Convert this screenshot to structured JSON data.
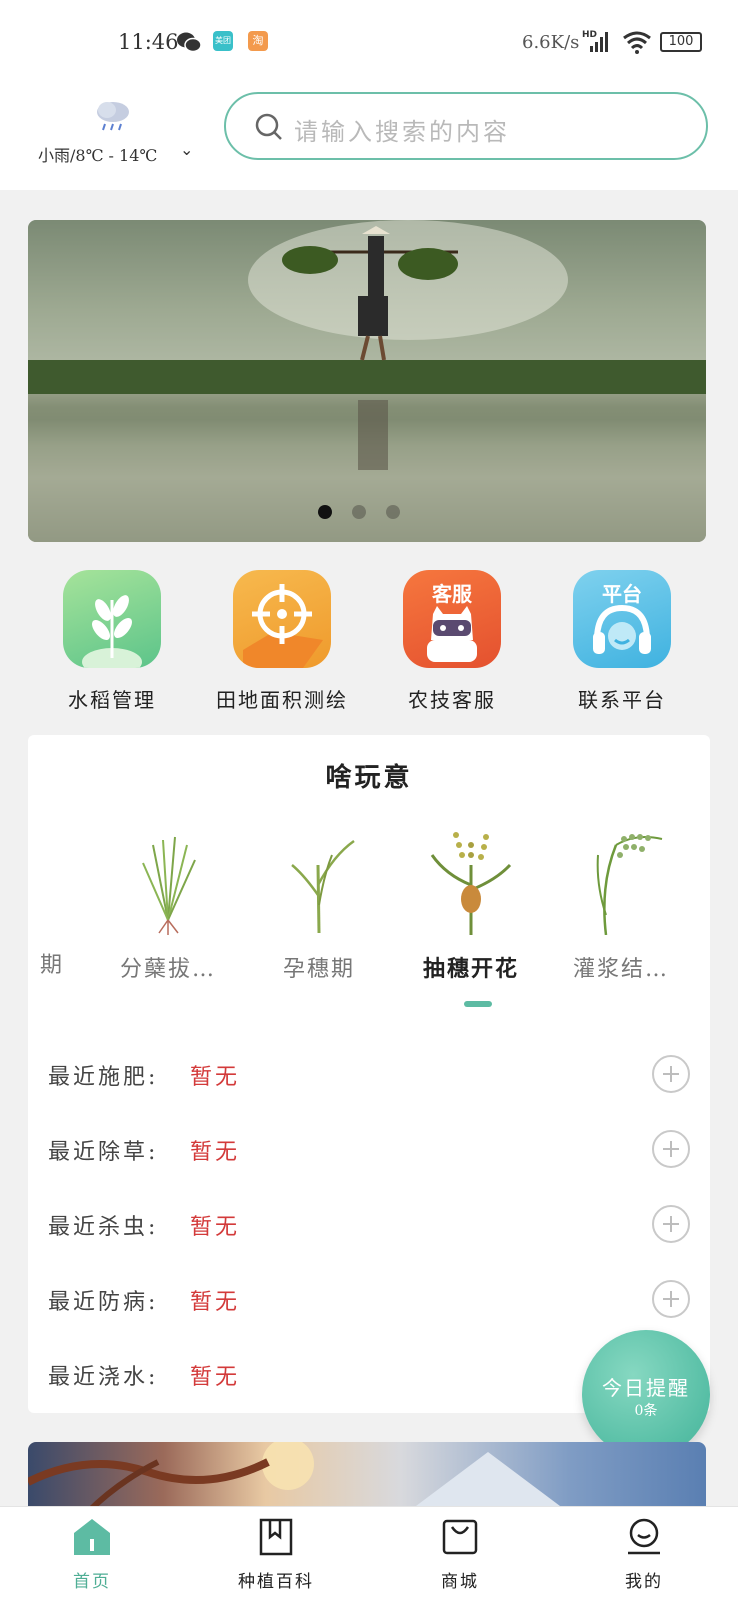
{
  "status_bar": {
    "time": "11:46",
    "net_speed": "6.6K/s",
    "battery": "100",
    "app_icon_1": "美团",
    "app_icon_2": "淘"
  },
  "header": {
    "weather": "小雨/8℃ - 14℃",
    "search_placeholder": "请输入搜索的内容"
  },
  "categories": [
    {
      "label": "水稻管理",
      "icon": "rice-plant-icon",
      "color": "#7fd08e"
    },
    {
      "label": "田地面积测绘",
      "icon": "crosshair-field-icon",
      "color": "#f2a13a",
      "icon_text": ""
    },
    {
      "label": "农技客服",
      "icon": "robot-service-icon",
      "color": "#ee6a3c",
      "icon_text": "客服"
    },
    {
      "label": "联系平台",
      "icon": "headset-icon",
      "color": "#55bde3",
      "icon_text": "平台"
    }
  ],
  "growth_card": {
    "title": "啥玩意",
    "stages": [
      {
        "label": "期"
      },
      {
        "label": "分蘖拔…"
      },
      {
        "label": "孕穗期"
      },
      {
        "label": "抽穗开花"
      },
      {
        "label": "灌浆结…"
      }
    ],
    "active_stage": "抽穗开花",
    "records": [
      {
        "label": "最近施肥:",
        "value": "暂无"
      },
      {
        "label": "最近除草:",
        "value": "暂无"
      },
      {
        "label": "最近杀虫:",
        "value": "暂无"
      },
      {
        "label": "最近防病:",
        "value": "暂无"
      },
      {
        "label": "最近浇水:",
        "value": "暂无"
      }
    ]
  },
  "reminder": {
    "title": "今日提醒",
    "count": "0条"
  },
  "bottom_nav": [
    {
      "label": "首页",
      "active": true
    },
    {
      "label": "种植百科",
      "active": false
    },
    {
      "label": "商城",
      "active": false
    },
    {
      "label": "我的",
      "active": false
    }
  ],
  "colors": {
    "accent": "#5dbba3",
    "value_red": "#d33a3a"
  }
}
